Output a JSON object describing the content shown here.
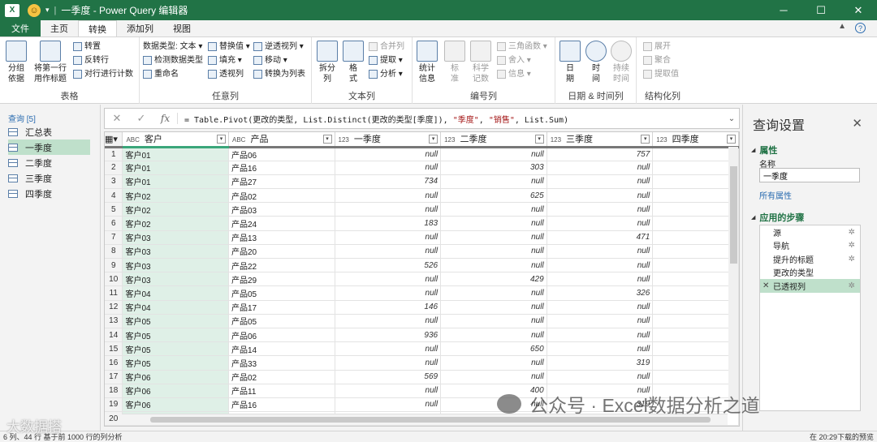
{
  "window": {
    "title": "一季度 - Power Query 编辑器"
  },
  "tabs": [
    "文件",
    "主页",
    "转换",
    "添加列",
    "视图"
  ],
  "ribbon": {
    "table_group": {
      "label": "表格",
      "group_by": "分组\n依据",
      "first_row": "将第一行\n用作标题",
      "transpose": "转置",
      "reverse_rows": "反转行",
      "count_rows": "对行进行计数"
    },
    "any_col_group": {
      "label": "任意列",
      "data_type": "数据类型: 文本",
      "detect_type": "检测数据类型",
      "rename": "重命名",
      "replace": "替换值",
      "fill": "填充",
      "pivot": "透视列",
      "unpivot": "逆透视列",
      "move": "移动",
      "to_list": "转换为列表"
    },
    "text_group": {
      "label": "文本列",
      "split": "拆分\n列",
      "format": "格\n式",
      "merge": "合并列",
      "extract": "提取",
      "parse": "分析"
    },
    "number_group": {
      "label": "编号列",
      "stats": "统计\n信息",
      "standard": "标\n准",
      "scientific": "科学\n记数",
      "trig": "三角函数",
      "rounding": "舍入",
      "info": "信息"
    },
    "datetime_group": {
      "label": "日期 & 时间列",
      "date": "日\n期",
      "time": "时\n间",
      "duration": "持续\n时间"
    },
    "struct_group": {
      "label": "结构化列",
      "expand": "展开",
      "aggregate": "聚合",
      "extract_values": "提取值"
    }
  },
  "queries": {
    "header": "查询 [5]",
    "items": [
      "汇总表",
      "一季度",
      "二季度",
      "三季度",
      "四季度"
    ],
    "selected": 1
  },
  "formula": {
    "prefix": "= Table.Pivot(更改的类型, List.Distinct(更改的类型[季度]), ",
    "s1": "\"季度\"",
    "mid": ", ",
    "s2": "\"销售\"",
    "suffix": ", List.Sum)"
  },
  "grid": {
    "columns": [
      {
        "type": "ABC",
        "name": "客户"
      },
      {
        "type": "ABC",
        "name": "产品"
      },
      {
        "type": "123",
        "name": "一季度"
      },
      {
        "type": "123",
        "name": "二季度"
      },
      {
        "type": "123",
        "name": "三季度"
      },
      {
        "type": "123",
        "name": "四季度"
      }
    ],
    "rows": [
      [
        "1",
        "客户01",
        "产品06",
        "null",
        "null",
        "757"
      ],
      [
        "2",
        "客户01",
        "产品16",
        "null",
        "303",
        "null"
      ],
      [
        "3",
        "客户01",
        "产品27",
        "734",
        "null",
        "null"
      ],
      [
        "4",
        "客户02",
        "产品02",
        "null",
        "625",
        "null"
      ],
      [
        "5",
        "客户02",
        "产品03",
        "null",
        "null",
        "null"
      ],
      [
        "6",
        "客户02",
        "产品24",
        "183",
        "null",
        "null"
      ],
      [
        "7",
        "客户03",
        "产品13",
        "null",
        "null",
        "471"
      ],
      [
        "8",
        "客户03",
        "产品20",
        "null",
        "null",
        "null"
      ],
      [
        "9",
        "客户03",
        "产品22",
        "526",
        "null",
        "null"
      ],
      [
        "10",
        "客户03",
        "产品29",
        "null",
        "429",
        "null"
      ],
      [
        "11",
        "客户04",
        "产品05",
        "null",
        "null",
        "326"
      ],
      [
        "12",
        "客户04",
        "产品17",
        "146",
        "null",
        "null"
      ],
      [
        "13",
        "客户05",
        "产品05",
        "null",
        "null",
        "null"
      ],
      [
        "14",
        "客户05",
        "产品06",
        "936",
        "null",
        "null"
      ],
      [
        "15",
        "客户05",
        "产品14",
        "null",
        "650",
        "null"
      ],
      [
        "16",
        "客户05",
        "产品33",
        "null",
        "null",
        "319"
      ],
      [
        "17",
        "客户06",
        "产品02",
        "569",
        "null",
        "null"
      ],
      [
        "18",
        "客户06",
        "产品11",
        "null",
        "400",
        "null"
      ],
      [
        "19",
        "客户06",
        "产品16",
        "null",
        "null",
        "319"
      ],
      [
        "20",
        "",
        "",
        "",
        "",
        ""
      ]
    ]
  },
  "settings": {
    "title": "查询设置",
    "props_header": "属性",
    "name_label": "名称",
    "name_value": "一季度",
    "all_props": "所有属性",
    "steps_header": "应用的步骤",
    "steps": [
      "源",
      "导航",
      "提升的标题",
      "更改的类型",
      "已透视列"
    ]
  },
  "status": {
    "left": "6 列、44 行   基于前 1000 行的列分析",
    "right": "在 20:29下载的预览"
  },
  "watermark": {
    "main": "公众号 · Excel数据分析之道",
    "corner": "大数据搭"
  }
}
